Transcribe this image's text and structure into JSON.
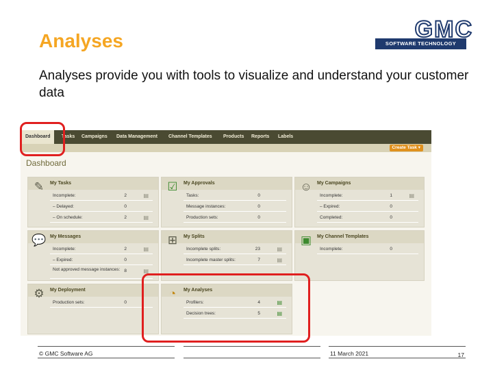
{
  "slide": {
    "title": "Analyses",
    "subtitle": "Analyses provide you with tools to visualize and understand your customer data"
  },
  "logo": {
    "text": "GMC",
    "tagline": "SOFTWARE TECHNOLOGY",
    "color": "#1f3a6e"
  },
  "app": {
    "nav": [
      "Dashboard",
      "Tasks",
      "Campaigns",
      "Data Management",
      "Channel Templates",
      "Products",
      "Reports",
      "Labels"
    ],
    "create_button": "Create Task ▾",
    "page_heading": "Dashboard"
  },
  "panels": {
    "tasks": {
      "title": "My Tasks",
      "icon": "notepad-icon",
      "rows": [
        {
          "label": "Incomplete:",
          "value": "2"
        },
        {
          "label": "– Delayed:",
          "value": "0"
        },
        {
          "label": "– On schedule:",
          "value": "2"
        }
      ]
    },
    "approvals": {
      "title": "My Approvals",
      "icon": "checkmark-box-icon",
      "rows": [
        {
          "label": "Tasks:",
          "value": "0"
        },
        {
          "label": "Message instances:",
          "value": "0"
        },
        {
          "label": "Production sets:",
          "value": "0"
        }
      ]
    },
    "campaigns": {
      "title": "My Campaigns",
      "icon": "people-group-icon",
      "rows": [
        {
          "label": "Incomplete:",
          "value": "1"
        },
        {
          "label": "– Expired:",
          "value": "0"
        },
        {
          "label": "Completed:",
          "value": "0"
        }
      ]
    },
    "messages": {
      "title": "My Messages",
      "icon": "speech-bubbles-icon",
      "rows": [
        {
          "label": "Incomplete:",
          "value": "2"
        },
        {
          "label": "– Expired:",
          "value": "0"
        },
        {
          "label": "Not approved message instances:",
          "value": "8"
        }
      ]
    },
    "splits": {
      "title": "My Splits",
      "icon": "split-icon",
      "rows": [
        {
          "label": "Incomplete splits:",
          "value": "23"
        },
        {
          "label": "Incomplete master splits:",
          "value": "7"
        }
      ]
    },
    "channel_templates": {
      "title": "My Channel Templates",
      "icon": "devices-icon",
      "rows": [
        {
          "label": "Incomplete:",
          "value": "0"
        }
      ]
    },
    "deployment": {
      "title": "My Deployment",
      "icon": "deployment-icon",
      "rows": [
        {
          "label": "Production sets:",
          "value": "0"
        }
      ]
    },
    "analyses": {
      "title": "My Analyses",
      "icon": "pie-chart-icon",
      "rows": [
        {
          "label": "Profilers:",
          "value": "4"
        },
        {
          "label": "Decision trees:",
          "value": "5"
        }
      ]
    }
  },
  "footer": {
    "copyright": "© GMC Software AG",
    "date": "11 March 2021",
    "page": "17"
  },
  "colors": {
    "title": "#f5a623",
    "highlight": "#e01f1f",
    "nav_bg": "#4a4a32",
    "button": "#e0911e"
  }
}
